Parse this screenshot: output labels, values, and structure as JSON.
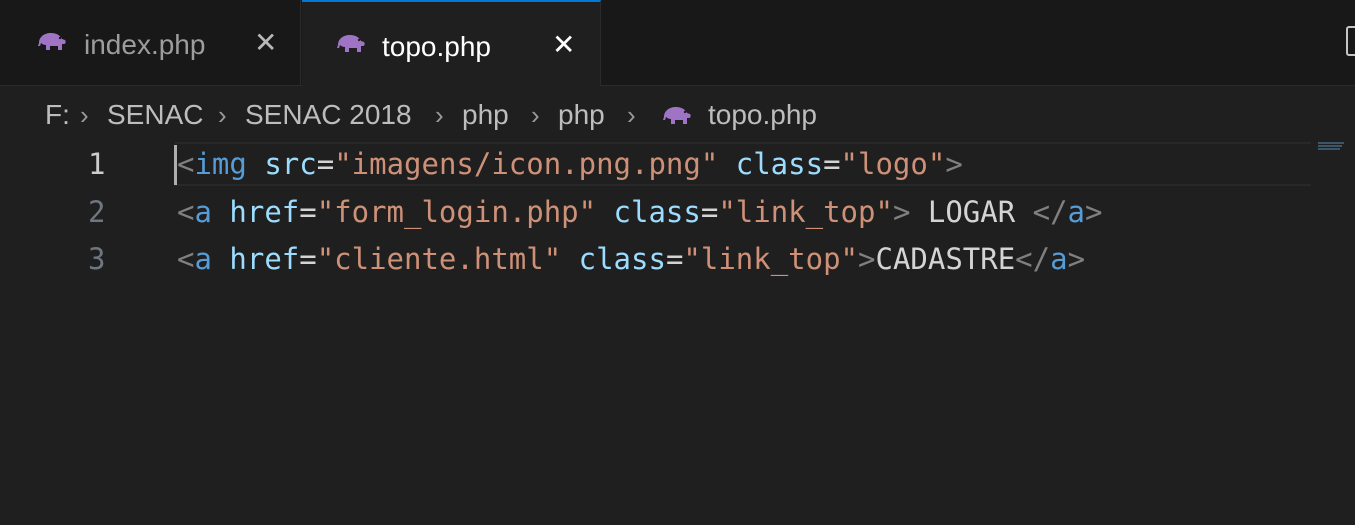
{
  "tabs": [
    {
      "label": "index.php",
      "icon": "php-elephant-icon",
      "active": false
    },
    {
      "label": "topo.php",
      "icon": "php-elephant-icon",
      "active": true
    }
  ],
  "breadcrumb": [
    "F:",
    "SENAC",
    "SENAC 2018",
    "php",
    "php",
    "topo.php"
  ],
  "editor": {
    "line_numbers": [
      "1",
      "2",
      "3"
    ],
    "lines": [
      [
        {
          "t": "<",
          "k": "punct"
        },
        {
          "t": "img",
          "k": "tag"
        },
        {
          "t": " ",
          "k": "text"
        },
        {
          "t": "src",
          "k": "attr"
        },
        {
          "t": "=",
          "k": "text"
        },
        {
          "t": "\"imagens/icon.png.png\"",
          "k": "str"
        },
        {
          "t": " ",
          "k": "text"
        },
        {
          "t": "class",
          "k": "attr"
        },
        {
          "t": "=",
          "k": "text"
        },
        {
          "t": "\"logo\"",
          "k": "str"
        },
        {
          "t": ">",
          "k": "punct"
        }
      ],
      [
        {
          "t": "<",
          "k": "punct"
        },
        {
          "t": "a",
          "k": "tag"
        },
        {
          "t": " ",
          "k": "text"
        },
        {
          "t": "href",
          "k": "attr"
        },
        {
          "t": "=",
          "k": "text"
        },
        {
          "t": "\"form_login.php\"",
          "k": "str"
        },
        {
          "t": " ",
          "k": "text"
        },
        {
          "t": "class",
          "k": "attr"
        },
        {
          "t": "=",
          "k": "text"
        },
        {
          "t": "\"link_top\"",
          "k": "str"
        },
        {
          "t": ">",
          "k": "punct"
        },
        {
          "t": " LOGAR ",
          "k": "text"
        },
        {
          "t": "</",
          "k": "punct"
        },
        {
          "t": "a",
          "k": "tag"
        },
        {
          "t": ">",
          "k": "punct"
        }
      ],
      [
        {
          "t": "<",
          "k": "punct"
        },
        {
          "t": "a",
          "k": "tag"
        },
        {
          "t": " ",
          "k": "text"
        },
        {
          "t": "href",
          "k": "attr"
        },
        {
          "t": "=",
          "k": "text"
        },
        {
          "t": "\"cliente.html\"",
          "k": "str"
        },
        {
          "t": " ",
          "k": "text"
        },
        {
          "t": "class",
          "k": "attr"
        },
        {
          "t": "=",
          "k": "text"
        },
        {
          "t": "\"link_top\"",
          "k": "str"
        },
        {
          "t": ">",
          "k": "punct"
        },
        {
          "t": "CADASTRE",
          "k": "text"
        },
        {
          "t": "</",
          "k": "punct"
        },
        {
          "t": "a",
          "k": "tag"
        },
        {
          "t": ">",
          "k": "punct"
        }
      ]
    ]
  },
  "colors": {
    "background": "#1f1f1f",
    "tag": "#569cd6",
    "attribute": "#9cdcfe",
    "string": "#ce9178",
    "punctuation": "#808080",
    "php_icon": "#a074c4",
    "active_tab_border": "#0078d4"
  }
}
